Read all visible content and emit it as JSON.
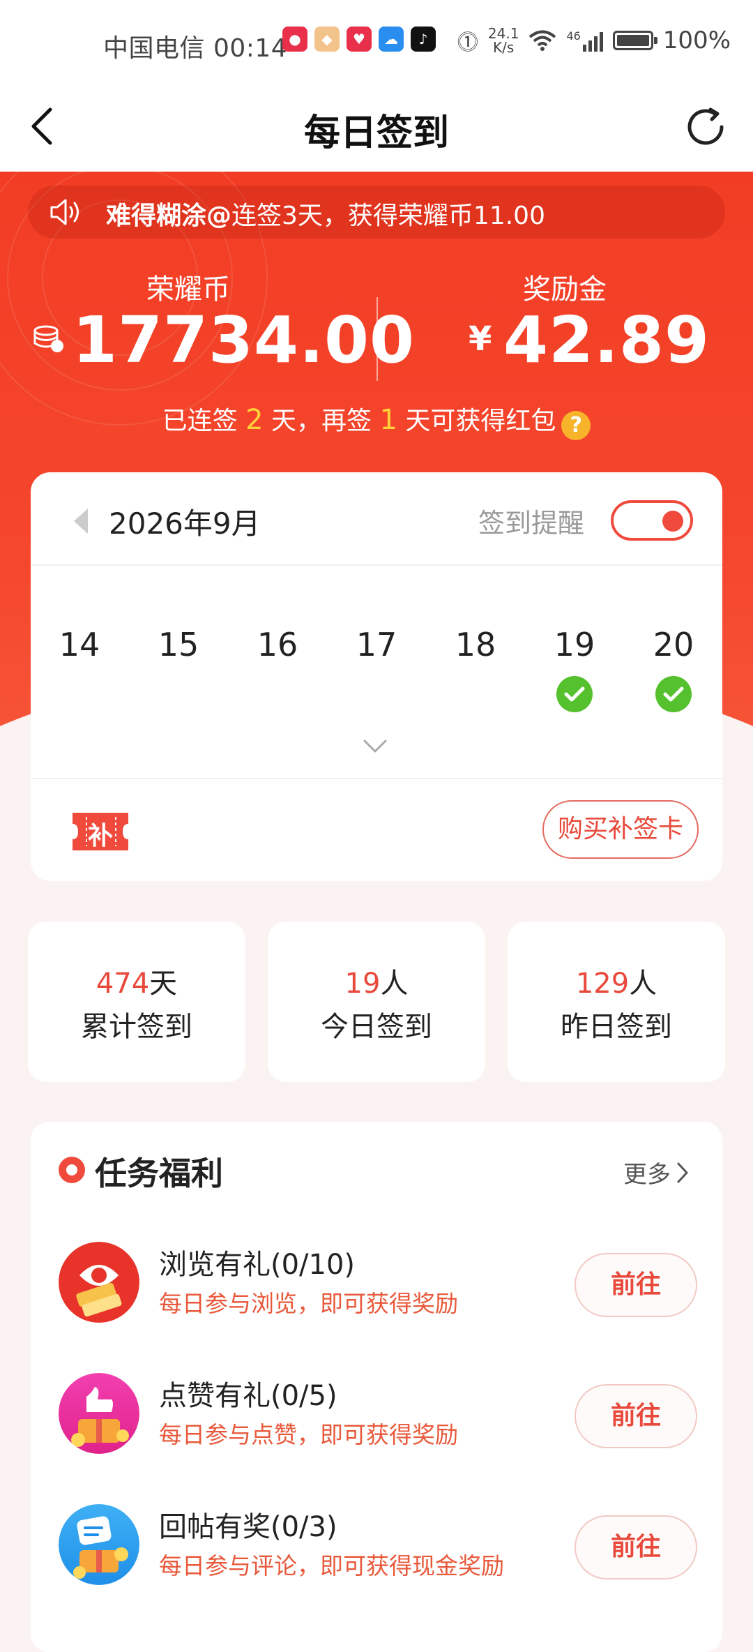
{
  "status_bar": {
    "carrier_time": "中国电信 00:14",
    "net_speed_value": "24.1",
    "net_speed_unit": "K/s",
    "signal": "46",
    "battery": "100%"
  },
  "nav": {
    "title": "每日签到"
  },
  "ticker": {
    "user": "难得糊涂@",
    "message": "连签3天，获得荣耀币11.00"
  },
  "wallet": {
    "coins_label": "荣耀币",
    "coins_value": "17734.00",
    "bonus_label": "奖励金",
    "bonus_currency": "¥",
    "bonus_value": "42.89"
  },
  "streak": {
    "prefix": "已连签 ",
    "days": "2",
    "middle": " 天，再签 ",
    "remaining": "1",
    "suffix": " 天可获得红包",
    "help": "?"
  },
  "calendar": {
    "month": "2026年9月",
    "reminder_label": "签到提醒",
    "reminder_on": true,
    "days": [
      {
        "day": "14",
        "checked": false
      },
      {
        "day": "15",
        "checked": false
      },
      {
        "day": "16",
        "checked": false
      },
      {
        "day": "17",
        "checked": false
      },
      {
        "day": "18",
        "checked": false
      },
      {
        "day": "19",
        "checked": true
      },
      {
        "day": "20",
        "checked": true
      }
    ],
    "makeup_icon_text": "补",
    "buy_card_label": "购买补签卡"
  },
  "stats": [
    {
      "value": "474",
      "unit": "天",
      "label": "累计签到"
    },
    {
      "value": "19",
      "unit": "人",
      "label": "今日签到"
    },
    {
      "value": "129",
      "unit": "人",
      "label": "昨日签到"
    }
  ],
  "tasks": {
    "title": "任务福利",
    "more_label": "更多",
    "items": [
      {
        "name": "浏览有礼(0/10)",
        "desc": "每日参与浏览，即可获得奖励",
        "button": "前往",
        "icon": "browse-gift-icon"
      },
      {
        "name": "点赞有礼(0/5)",
        "desc": "每日参与点赞，即可获得奖励",
        "button": "前往",
        "icon": "like-gift-icon"
      },
      {
        "name": "回帖有奖(0/3)",
        "desc": "每日参与评论，即可获得现金奖励",
        "button": "前往",
        "icon": "reply-gift-icon"
      }
    ]
  },
  "colors": {
    "brand_red": "#f23d24",
    "accent_red": "#e8493b",
    "check_green": "#55c12e",
    "highlight_yellow": "#ffd23a"
  }
}
